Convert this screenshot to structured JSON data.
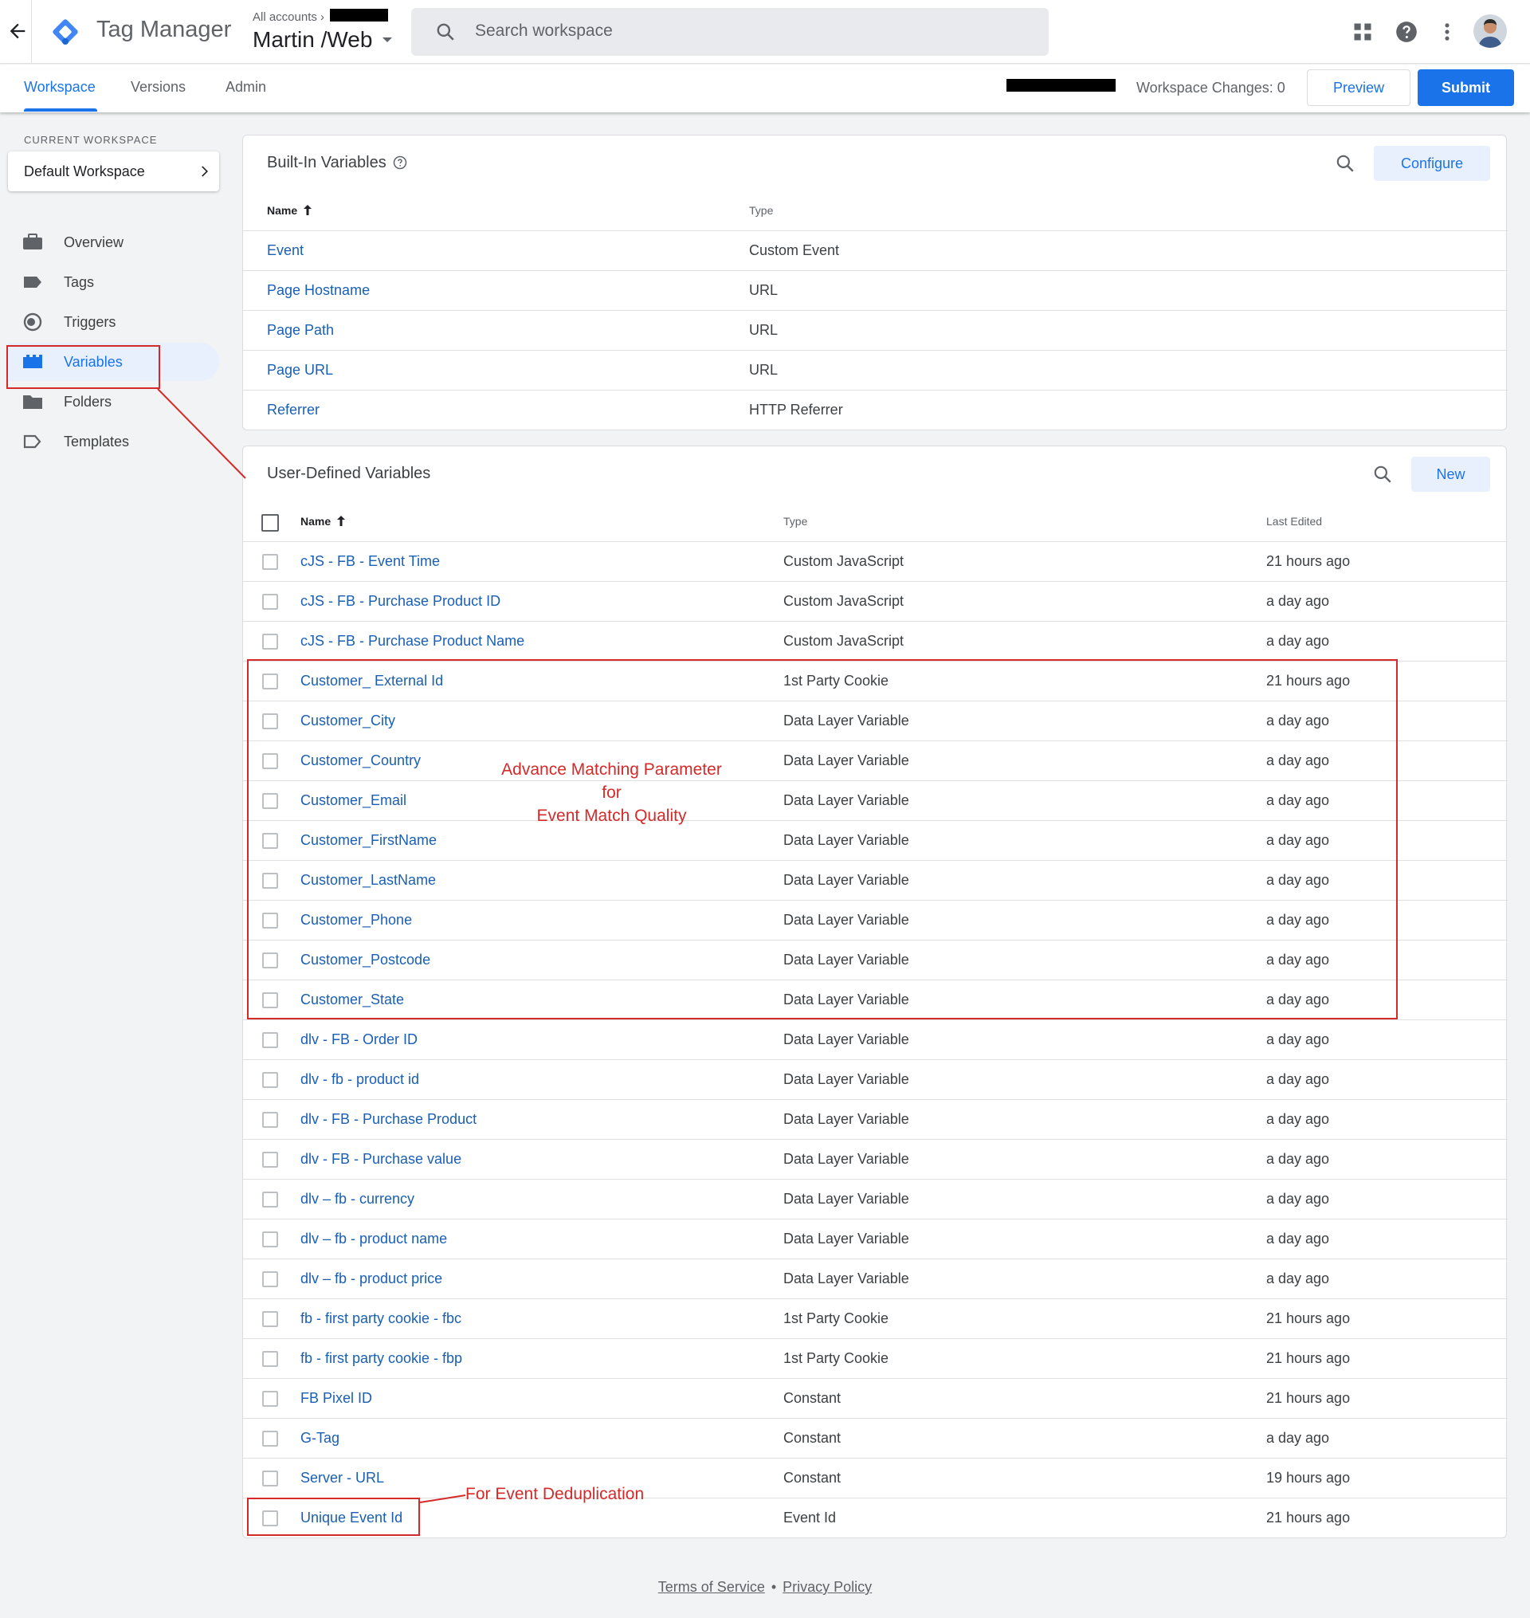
{
  "header": {
    "product_name": "Tag Manager",
    "account_path": "All accounts",
    "account_chevron": "›",
    "container_name": "Martin /Web",
    "search_placeholder": "Search workspace"
  },
  "nav": {
    "tabs": [
      "Workspace",
      "Versions",
      "Admin"
    ],
    "workspace_changes": "Workspace Changes: 0",
    "preview_label": "Preview",
    "submit_label": "Submit"
  },
  "sidebar": {
    "current_workspace_label": "CURRENT WORKSPACE",
    "workspace_name": "Default Workspace",
    "items": [
      {
        "label": "Overview",
        "icon": "briefcase-icon"
      },
      {
        "label": "Tags",
        "icon": "tag-icon"
      },
      {
        "label": "Triggers",
        "icon": "trigger-icon"
      },
      {
        "label": "Variables",
        "icon": "variables-icon",
        "active": true
      },
      {
        "label": "Folders",
        "icon": "folder-icon"
      },
      {
        "label": "Templates",
        "icon": "template-icon"
      }
    ]
  },
  "builtin": {
    "title": "Built-In Variables",
    "configure_label": "Configure",
    "columns": [
      "Name",
      "Type"
    ],
    "rows": [
      {
        "name": "Event",
        "type": "Custom Event"
      },
      {
        "name": "Page Hostname",
        "type": "URL"
      },
      {
        "name": "Page Path",
        "type": "URL"
      },
      {
        "name": "Page URL",
        "type": "URL"
      },
      {
        "name": "Referrer",
        "type": "HTTP Referrer"
      }
    ]
  },
  "user_defined": {
    "title": "User-Defined Variables",
    "new_label": "New",
    "columns": [
      "Name",
      "Type",
      "Last Edited"
    ],
    "rows": [
      {
        "name": "cJS - FB - Event Time",
        "type": "Custom JavaScript",
        "edited": "21 hours ago"
      },
      {
        "name": "cJS - FB - Purchase Product ID",
        "type": "Custom JavaScript",
        "edited": "a day ago"
      },
      {
        "name": "cJS - FB - Purchase Product Name",
        "type": "Custom JavaScript",
        "edited": "a day ago"
      },
      {
        "name": "Customer_ External Id",
        "type": "1st Party Cookie",
        "edited": "21 hours ago"
      },
      {
        "name": "Customer_City",
        "type": "Data Layer Variable",
        "edited": "a day ago"
      },
      {
        "name": "Customer_Country",
        "type": "Data Layer Variable",
        "edited": "a day ago"
      },
      {
        "name": "Customer_Email",
        "type": "Data Layer Variable",
        "edited": "a day ago"
      },
      {
        "name": "Customer_FirstName",
        "type": "Data Layer Variable",
        "edited": "a day ago"
      },
      {
        "name": "Customer_LastName",
        "type": "Data Layer Variable",
        "edited": "a day ago"
      },
      {
        "name": "Customer_Phone",
        "type": "Data Layer Variable",
        "edited": "a day ago"
      },
      {
        "name": "Customer_Postcode",
        "type": "Data Layer Variable",
        "edited": "a day ago"
      },
      {
        "name": "Customer_State",
        "type": "Data Layer Variable",
        "edited": "a day ago"
      },
      {
        "name": "dlv - FB - Order ID",
        "type": "Data Layer Variable",
        "edited": "a day ago"
      },
      {
        "name": "dlv - fb - product id",
        "type": "Data Layer Variable",
        "edited": "a day ago"
      },
      {
        "name": "dlv - FB - Purchase Product",
        "type": "Data Layer Variable",
        "edited": "a day ago"
      },
      {
        "name": "dlv - FB - Purchase value",
        "type": "Data Layer Variable",
        "edited": "a day ago"
      },
      {
        "name": "dlv – fb - currency",
        "type": "Data Layer Variable",
        "edited": "a day ago"
      },
      {
        "name": "dlv – fb - product name",
        "type": "Data Layer Variable",
        "edited": "a day ago"
      },
      {
        "name": "dlv – fb - product price",
        "type": "Data Layer Variable",
        "edited": "a day ago"
      },
      {
        "name": "fb - first party cookie - fbc",
        "type": "1st Party Cookie",
        "edited": "21 hours ago"
      },
      {
        "name": "fb - first party cookie - fbp",
        "type": "1st Party Cookie",
        "edited": "21 hours ago"
      },
      {
        "name": "FB Pixel ID",
        "type": "Constant",
        "edited": "21 hours ago"
      },
      {
        "name": "G-Tag",
        "type": "Constant",
        "edited": "a day ago"
      },
      {
        "name": "Server - URL",
        "type": "Constant",
        "edited": "19 hours ago"
      },
      {
        "name": "Unique Event Id",
        "type": "Event Id",
        "edited": "21 hours ago"
      }
    ]
  },
  "annotations": {
    "advance_matching": [
      "Advance Matching Parameter",
      "for",
      "Event Match Quality"
    ],
    "dedup": "For Event Deduplication"
  },
  "footer": {
    "terms": "Terms of Service",
    "separator": "•",
    "privacy": "Privacy Policy"
  },
  "colors": {
    "accent": "#1a73e8",
    "link": "#1a5fb4",
    "annotation": "#d42a2a",
    "active_nav_bg": "#e8f0fe"
  }
}
